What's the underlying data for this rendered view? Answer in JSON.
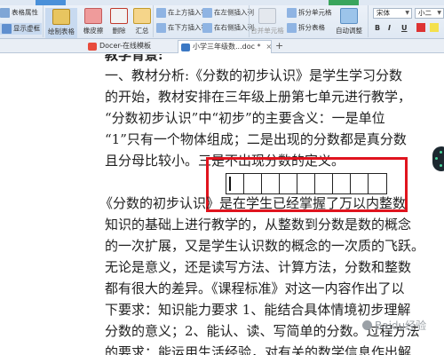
{
  "ribbon": {
    "table_props": "表格属性",
    "show_gridlines": "显示虚框",
    "draw_table": "绘制表格",
    "eraser": "橡皮擦",
    "delete": "删除",
    "summary": "汇总",
    "insert_above": "在上方插入行",
    "insert_below": "在下方插入行",
    "insert_left": "在左侧插入列",
    "insert_right": "在右侧插入列",
    "merge_cells": "合并单元格",
    "split_cells": "拆分单元格",
    "split_table": "拆分表格",
    "auto_fit": "自动调整",
    "font_name": "宋体",
    "font_size": "小二",
    "bold": "B",
    "italic": "I",
    "underline": "U"
  },
  "tabs": [
    {
      "label": "Docer-在线模板"
    },
    {
      "label": "小学三年级数...doc *"
    }
  ],
  "tab_close": "×",
  "new_tab": "+",
  "document": {
    "lines": [
      "教学背景:",
      "一、教材分析:《分数的初步认识》是学生学习分数",
      "的开始，教材安排在三年级上册第七单元进行教学，",
      "“分数初步认识”中“初步”的主要含义：一是单位",
      "“1”只有一个物体组成；二是出现的分数都是真分数",
      "且分母比较小。三是不出现分数的定义。",
      "《分数的初步认识》是在学生已经掌握了万以内整数",
      "知识的基础上进行教学的，从整数到分数是数的概念",
      "的一次扩展，又是学生认识数的概念的一次质的飞跃。",
      "无论是意义，还是读写方法、计算方法，分数和整数",
      "都有很大的差异。《课程标准》对这一内容作出了以",
      "下要求：知识能力要求 1、能结合具体情境初步理解",
      "分数的意义；2、能认、读、写简单的分数。过程方法",
      "的要求：能运用生活经验，对有关的数学信息作出解"
    ]
  },
  "table": {
    "cells": 9
  },
  "watermark": "Baidu经验",
  "colors": {
    "highlight": "#e0141e"
  }
}
